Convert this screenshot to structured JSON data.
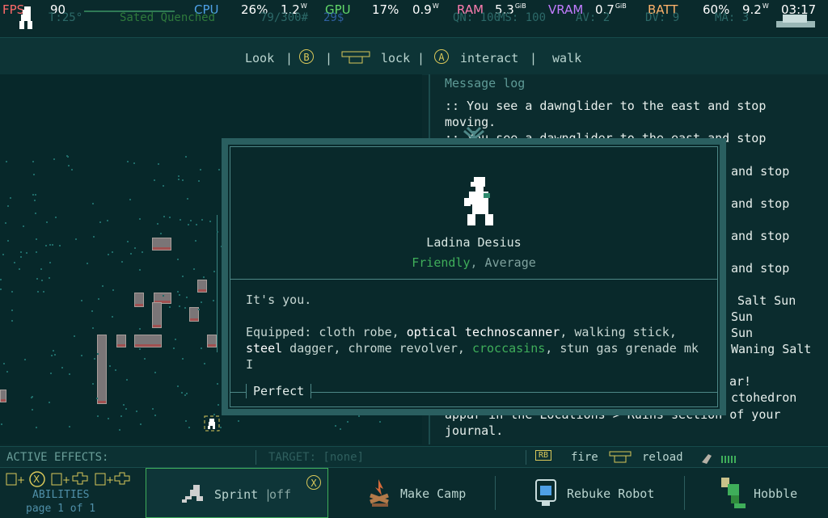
{
  "perf": {
    "fps_label": "FPS",
    "fps": "90",
    "cpu_label": "CPU",
    "cpu_pct": "26%",
    "cpu_w": "1.2",
    "cpu_w_unit": "W",
    "gpu_label": "GPU",
    "gpu_pct": "17%",
    "gpu_w": "0.9",
    "gpu_w_unit": "W",
    "ram_label": "RAM",
    "ram": "5.3",
    "ram_unit": "GiB",
    "vram_label": "VRAM",
    "vram": "0.7",
    "vram_unit": "GiB",
    "batt_label": "BATT",
    "batt_pct": "60%",
    "batt_w": "9.2",
    "batt_w_unit": "W",
    "time": "03:17"
  },
  "status_dim": {
    "temp": "T:25°",
    "hunger": "Sated Quenched",
    "weight": "79/300#",
    "money": "29$",
    "qn": "QN: 100",
    "ms": "MS: 100",
    "av": "AV: 2",
    "dv": "DV: 9",
    "ma": "MA: 3"
  },
  "topbar": {
    "look": "Look",
    "sep1": "|",
    "b_button": "B",
    "sep2": "|",
    "lock": "lock",
    "sep3": "|",
    "a_button": "A",
    "interact": "interact",
    "sep4": "|",
    "walk": "walk"
  },
  "log": {
    "title": "Message log",
    "lines": [
      ":: You see a dawnglider to the east and stop",
      "moving.",
      ":: You see a dawnglider to the east and stop",
      "and stop",
      "and stop",
      "and stop",
      "and stop",
      "Salt Sun",
      "Sun",
      "Sun",
      "Waning Salt",
      "ar!",
      "ctohedron",
      "appar in the Locations > Ruins section of your",
      "journal."
    ]
  },
  "dialog": {
    "name": "Ladina Desius",
    "attitude_1": "Friendly",
    "attitude_sep": ", ",
    "attitude_2": "Average",
    "line1": "It's you.",
    "equipped_label": "Equipped: ",
    "eq_1": "cloth robe",
    "eq_sep1": ", ",
    "eq_2": "optical technoscanner",
    "eq_sep2": ", ",
    "eq_3": "walking stick",
    "eq_sep3": ",",
    "eq_4": "steel",
    "eq_4b": " dagger, chrome revolver, ",
    "eq_5": "croccasins",
    "eq_6": ", stun gas grenade mk I",
    "health": "Perfect"
  },
  "effects": {
    "label": "ACTIVE EFFECTS:",
    "target": "TARGET: [none]",
    "rb": "RB",
    "fire": "fire",
    "reload": "reload"
  },
  "abilities": {
    "label": "ABILITIES",
    "page": "page 1 of 1",
    "x_button": "X",
    "items": [
      {
        "label": "Sprint",
        "state": "off"
      },
      {
        "label": "Make Camp"
      },
      {
        "label": "Rebuke Robot"
      },
      {
        "label": "Hobble"
      }
    ]
  },
  "colors": {
    "background": "#0a2a2c",
    "friendly": "#3fae5a",
    "accent_yellow": "#d9c85a",
    "text": "#b9d4cf"
  }
}
